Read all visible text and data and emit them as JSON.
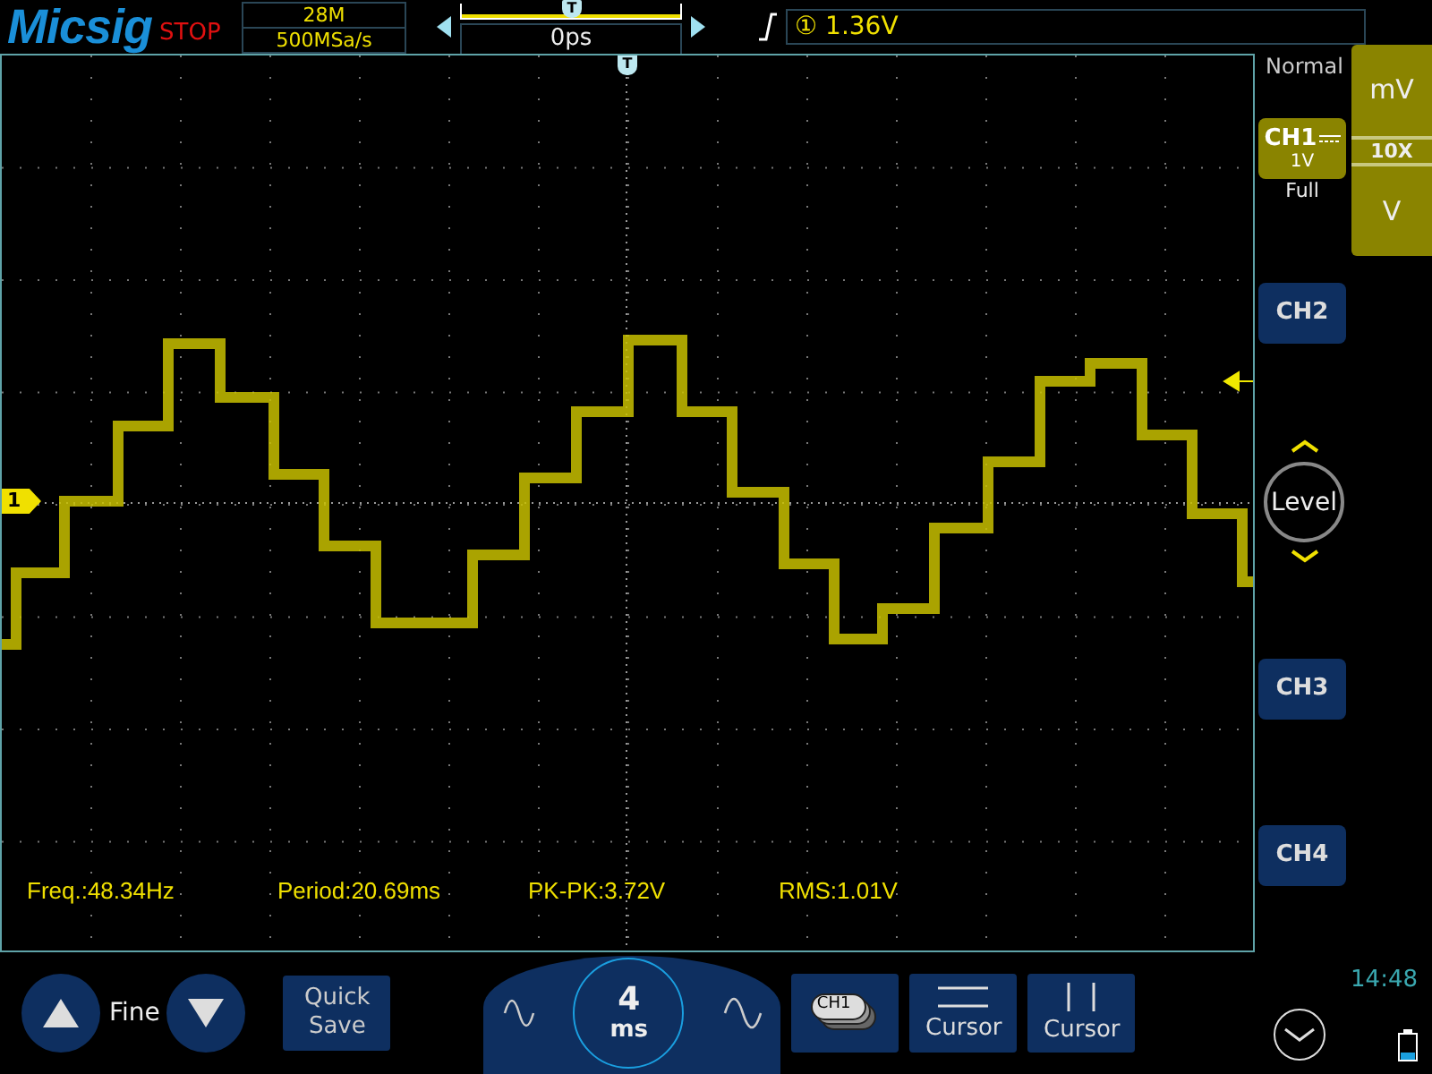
{
  "brand": {
    "logo": "Micsig",
    "run_state": "STOP"
  },
  "acquisition": {
    "memory_depth": "28M",
    "sample_rate": "500MSa/s"
  },
  "horizontal": {
    "memory_view": {
      "level": 1
    },
    "slider_marker": "T",
    "position": "0ps",
    "plot_marker": "T"
  },
  "trigger": {
    "source": "①",
    "level": "1.36V",
    "mode": "Normal"
  },
  "probe_panel": {
    "upper_unit": "mV",
    "attenuation": "10X",
    "lower_unit": "V"
  },
  "channels": [
    {
      "name": "CH1",
      "scale": "1V",
      "bandwidth": "Full",
      "selected": true
    },
    {
      "name": "CH2",
      "selected": false
    },
    {
      "name": "CH3",
      "selected": false
    },
    {
      "name": "CH4",
      "selected": false
    }
  ],
  "channel_marker": "1",
  "level_knob": "Level",
  "measurements": [
    "Freq.:48.34Hz",
    "Period:20.69ms",
    "PK-PK:3.72V",
    "RMS:1.01V"
  ],
  "bottom_bar": {
    "fine": "Fine",
    "quick_save": "Quick Save",
    "timebase": {
      "value": "4",
      "unit": "ms"
    },
    "channel_chip": "CH1",
    "cursor_buttons": [
      {
        "kind": "horizontal",
        "label": "Cursor"
      },
      {
        "kind": "vertical",
        "label": "Cursor"
      }
    ]
  },
  "status": {
    "time": "14:48"
  }
}
